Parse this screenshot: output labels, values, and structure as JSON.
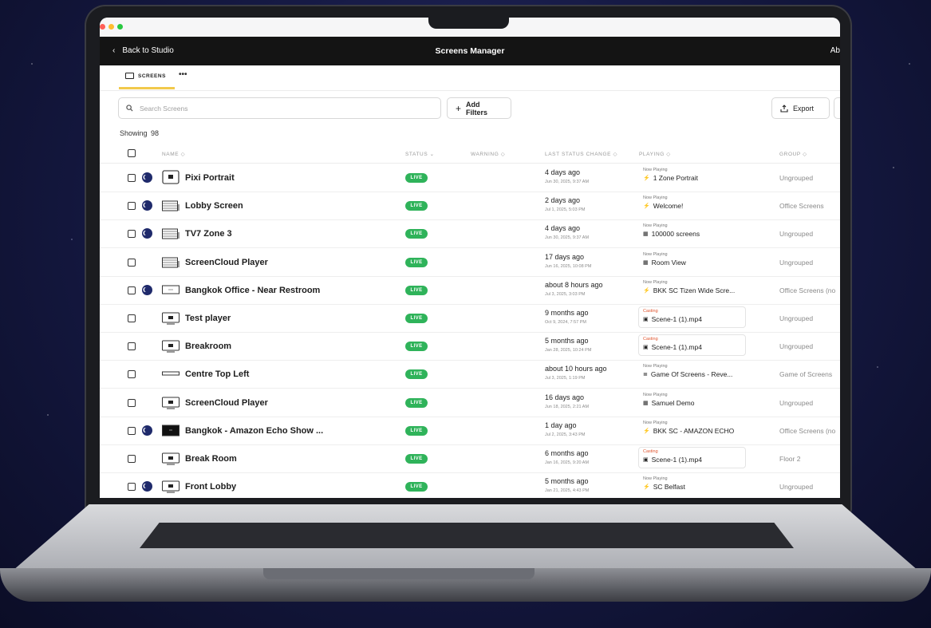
{
  "window": {
    "dots": [
      "#ff5f57",
      "#febc2e",
      "#28c840"
    ]
  },
  "topbar": {
    "back_label": "Back to Studio",
    "title": "Screens Manager",
    "right_label": "Ab"
  },
  "tabs": {
    "active_label": "SCREENS",
    "more_label": "•••"
  },
  "toolbar": {
    "search_placeholder": "Search Screens",
    "add_filters_label": "Add Filters",
    "export_label": "Export"
  },
  "showing": {
    "label": "Showing",
    "count": "98"
  },
  "columns": {
    "name": "NAME ◇",
    "status": "STATUS ⌄",
    "warning": "WARNING ◇",
    "last_status_change": "LAST STATUS CHANGE ◇",
    "playing": "PLAYING ◇",
    "group": "GROUP ◇"
  },
  "rows": [
    {
      "name": "Pixi Portrait",
      "moon": true,
      "device": "portrait",
      "status": "LIVE",
      "ago": "4 days ago",
      "date": "Jun 30, 2025, 9:37 AM",
      "play_kind": "Now Playing",
      "play_icon": "⚡",
      "play_title": "1 Zone Portrait",
      "casting": false,
      "group": "Ungrouped"
    },
    {
      "name": "Lobby Screen",
      "moon": true,
      "device": "bars",
      "status": "LIVE",
      "ago": "2 days ago",
      "date": "Jul 1, 2025, 5:03 PM",
      "play_kind": "Now Playing",
      "play_icon": "⚡",
      "play_title": "Welcome!",
      "casting": false,
      "group": "Office Screens"
    },
    {
      "name": "TV7 Zone 3",
      "moon": true,
      "device": "bars",
      "status": "LIVE",
      "ago": "4 days ago",
      "date": "Jun 30, 2025, 9:37 AM",
      "play_kind": "Now Playing",
      "play_icon": "▦",
      "play_title": "100000 screens",
      "casting": false,
      "group": "Ungrouped"
    },
    {
      "name": "ScreenCloud Player",
      "moon": false,
      "device": "bars",
      "status": "LIVE",
      "ago": "17 days ago",
      "date": "Jun 16, 2025, 10:08 PM",
      "play_kind": "Now Playing",
      "play_icon": "▦",
      "play_title": "Room View",
      "casting": false,
      "group": "Ungrouped"
    },
    {
      "name": "Bangkok Office - Near Restroom",
      "moon": true,
      "device": "wide",
      "status": "LIVE",
      "ago": "about 8 hours ago",
      "date": "Jul 3, 2025, 3:03 PM",
      "play_kind": "Now Playing",
      "play_icon": "⚡",
      "play_title": "BKK SC Tizen Wide Scre...",
      "casting": false,
      "group": "Office Screens (no"
    },
    {
      "name": "Test player",
      "moon": false,
      "device": "landscape",
      "status": "LIVE",
      "ago": "9 months ago",
      "date": "Oct 9, 2024, 7:57 PM",
      "play_kind": "Casting",
      "play_icon": "▣",
      "play_title": "Scene-1 (1).mp4",
      "casting": true,
      "group": "Ungrouped"
    },
    {
      "name": "Breakroom",
      "moon": false,
      "device": "landscape",
      "status": "LIVE",
      "ago": "5 months ago",
      "date": "Jan 28, 2025, 10:24 PM",
      "play_kind": "Casting",
      "play_icon": "▣",
      "play_title": "Scene-1 (1).mp4",
      "casting": true,
      "group": "Ungrouped"
    },
    {
      "name": "Centre Top Left",
      "moon": false,
      "device": "strip",
      "status": "LIVE",
      "ago": "about 10 hours ago",
      "date": "Jul 3, 2025, 1:19 PM",
      "play_kind": "Now Playing",
      "play_icon": "≣",
      "play_title": "Game Of Screens - Reve...",
      "casting": false,
      "group": "Game of Screens"
    },
    {
      "name": "ScreenCloud Player",
      "moon": false,
      "device": "landscape",
      "status": "LIVE",
      "ago": "16 days ago",
      "date": "Jun 18, 2025, 2:21 AM",
      "play_kind": "Now Playing",
      "play_icon": "▦",
      "play_title": "Samuel Demo",
      "casting": false,
      "group": "Ungrouped"
    },
    {
      "name": "Bangkok - Amazon Echo Show ...",
      "moon": true,
      "device": "dark",
      "status": "LIVE",
      "ago": "1 day ago",
      "date": "Jul 2, 2025, 3:43 PM",
      "play_kind": "Now Playing",
      "play_icon": "⚡",
      "play_title": "BKK SC - AMAZON ECHO",
      "casting": false,
      "group": "Office Screens (no"
    },
    {
      "name": "Break Room",
      "moon": false,
      "device": "landscape",
      "status": "LIVE",
      "ago": "6 months ago",
      "date": "Jan 16, 2025, 9:20 AM",
      "play_kind": "Casting",
      "play_icon": "▣",
      "play_title": "Scene-1 (1).mp4",
      "casting": true,
      "group": "Floor 2"
    },
    {
      "name": "Front Lobby",
      "moon": true,
      "device": "landscape",
      "status": "LIVE",
      "ago": "5 months ago",
      "date": "Jan 21, 2025, 4:43 PM",
      "play_kind": "Now Playing",
      "play_icon": "⚡",
      "play_title": "SC Belfast",
      "casting": false,
      "group": "Ungrouped"
    }
  ]
}
